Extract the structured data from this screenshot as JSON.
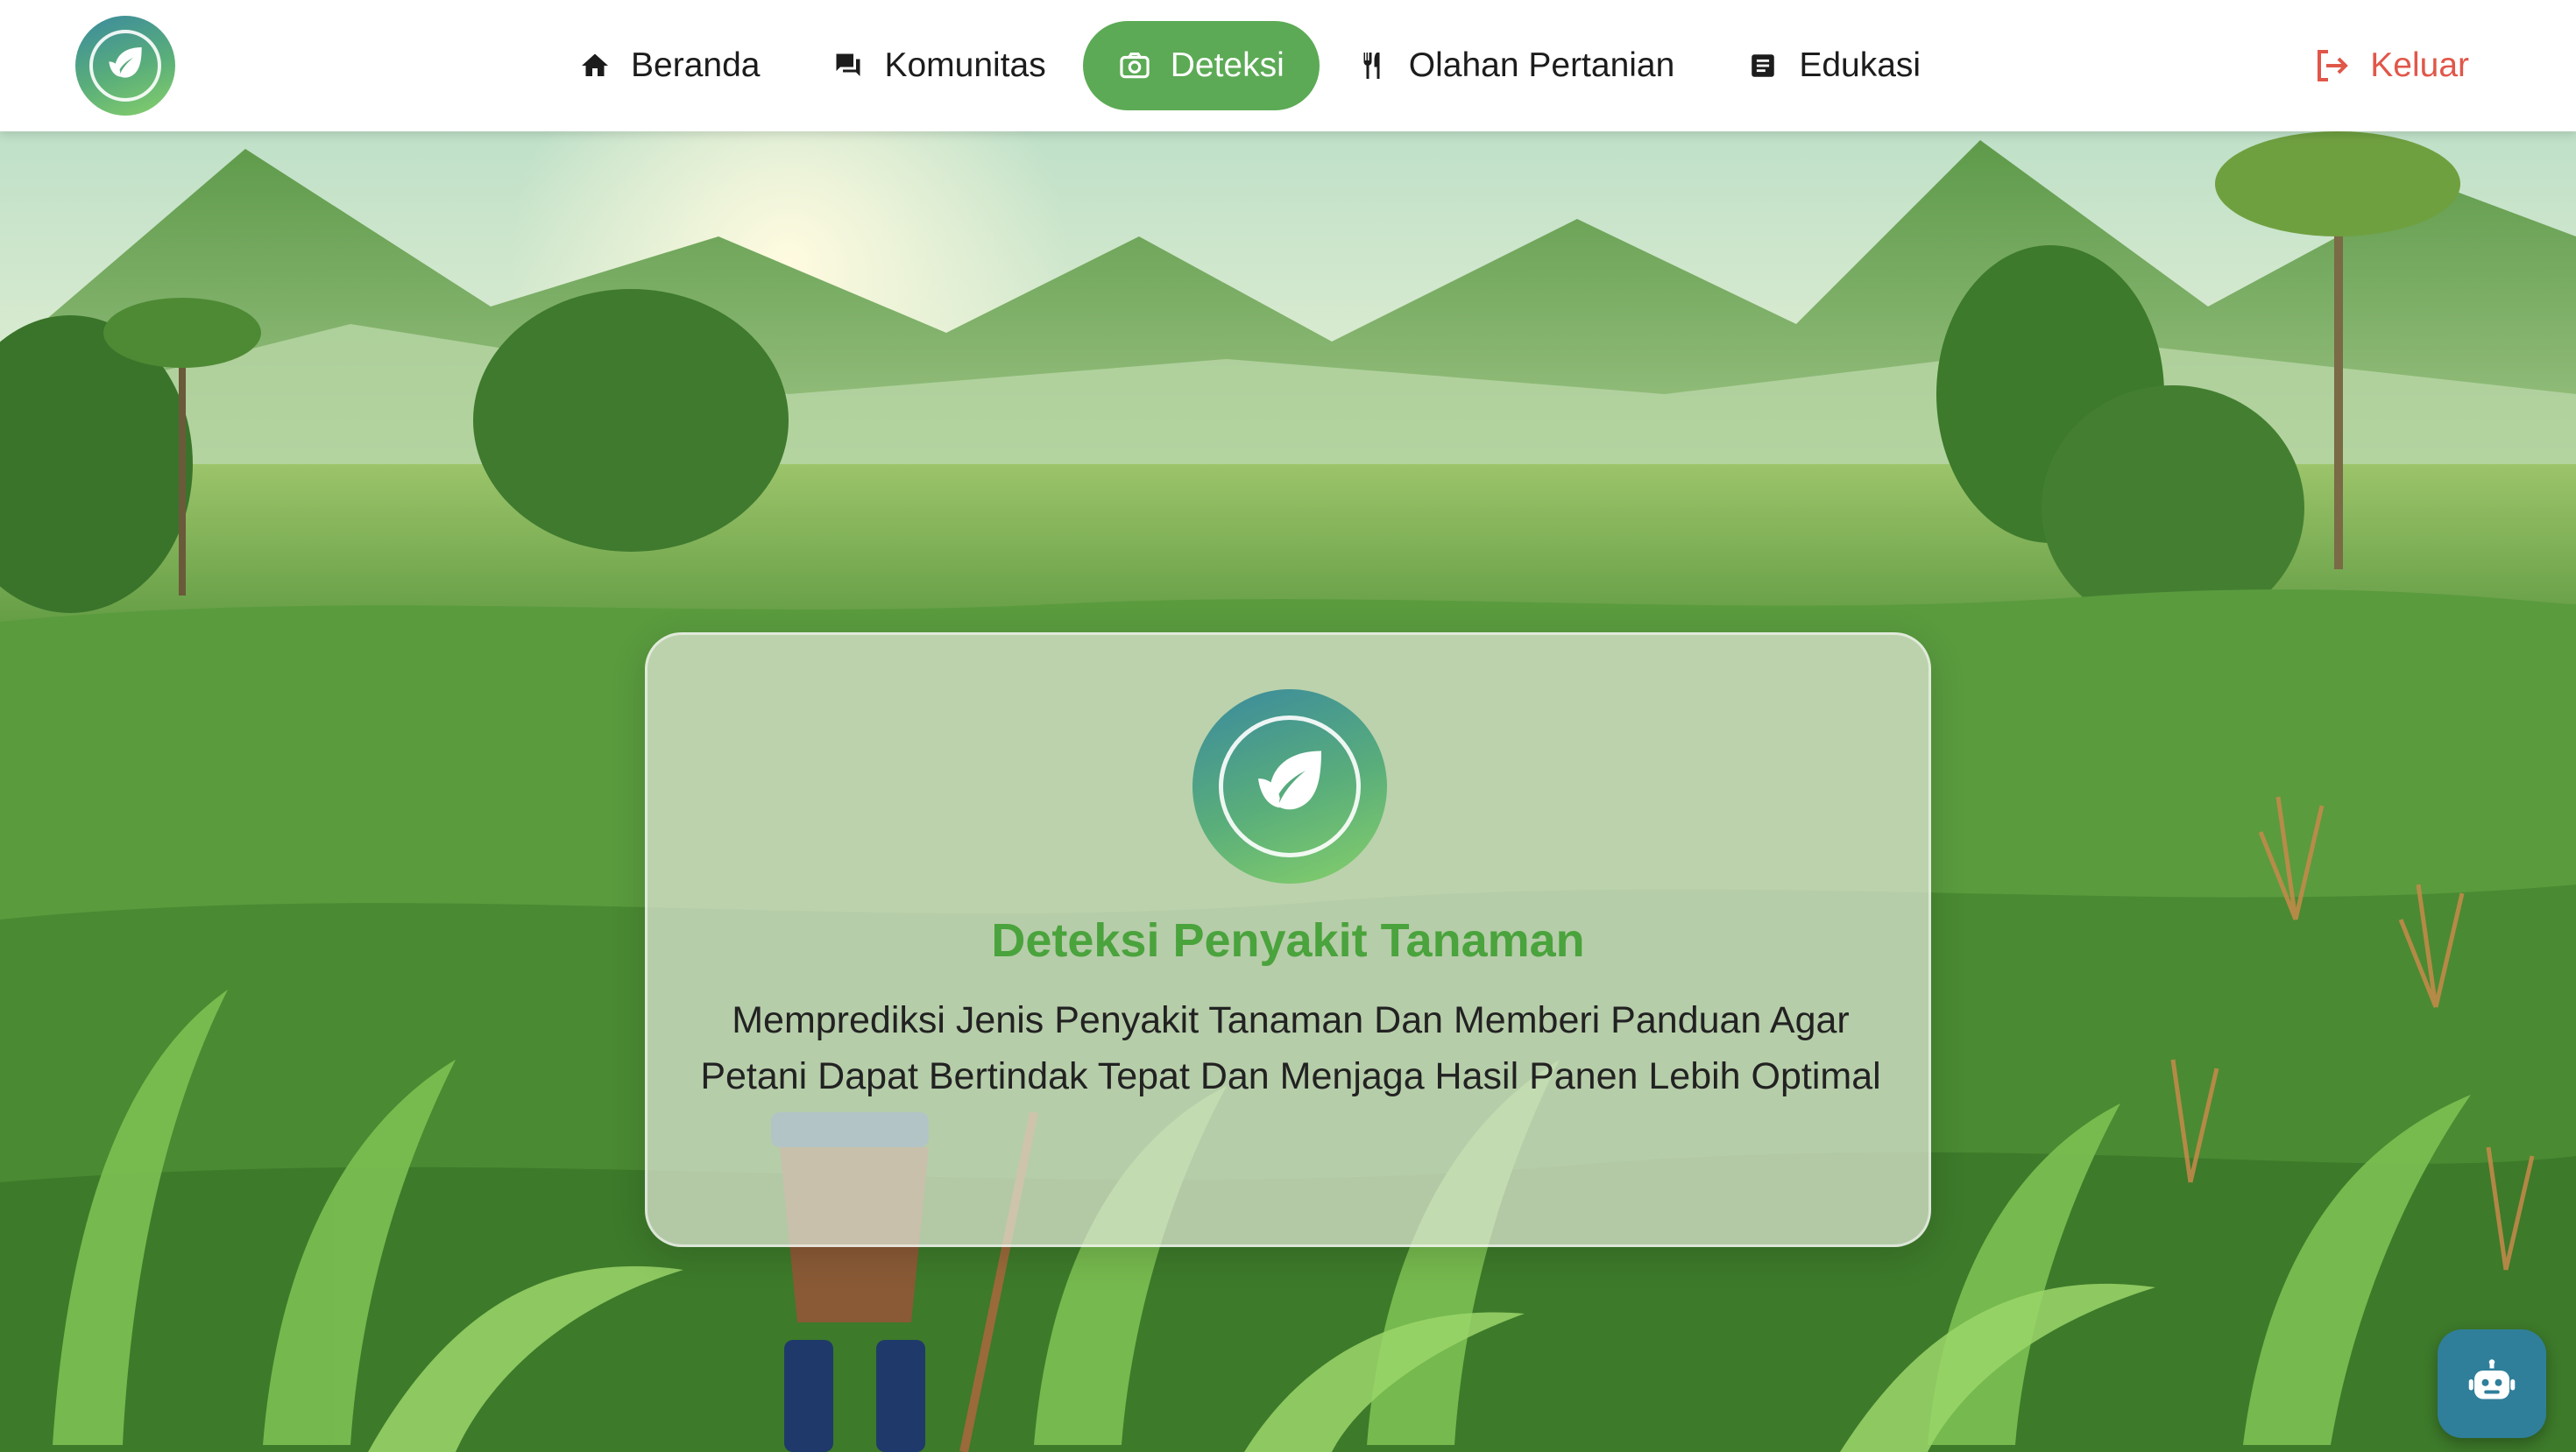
{
  "nav": {
    "items": [
      {
        "label": "Beranda",
        "icon": "home-icon"
      },
      {
        "label": "Komunitas",
        "icon": "forum-icon"
      },
      {
        "label": "Deteksi",
        "icon": "camera-icon",
        "active": true
      },
      {
        "label": "Olahan Pertanian",
        "icon": "utensils-icon"
      },
      {
        "label": "Edukasi",
        "icon": "article-icon"
      }
    ],
    "logout_label": "Keluar"
  },
  "hero": {
    "title": "Deteksi Penyakit Tanaman",
    "description": "Memprediksi Jenis Penyakit Tanaman Dan Memberi Panduan Agar Petani Dapat Bertindak Tepat Dan Menjaga Hasil Panen Lebih Optimal"
  },
  "colors": {
    "accent": "#5caa55",
    "title_green": "#4aa33c",
    "logout_red": "#e0574a",
    "chat_button": "#2f7f9b"
  }
}
